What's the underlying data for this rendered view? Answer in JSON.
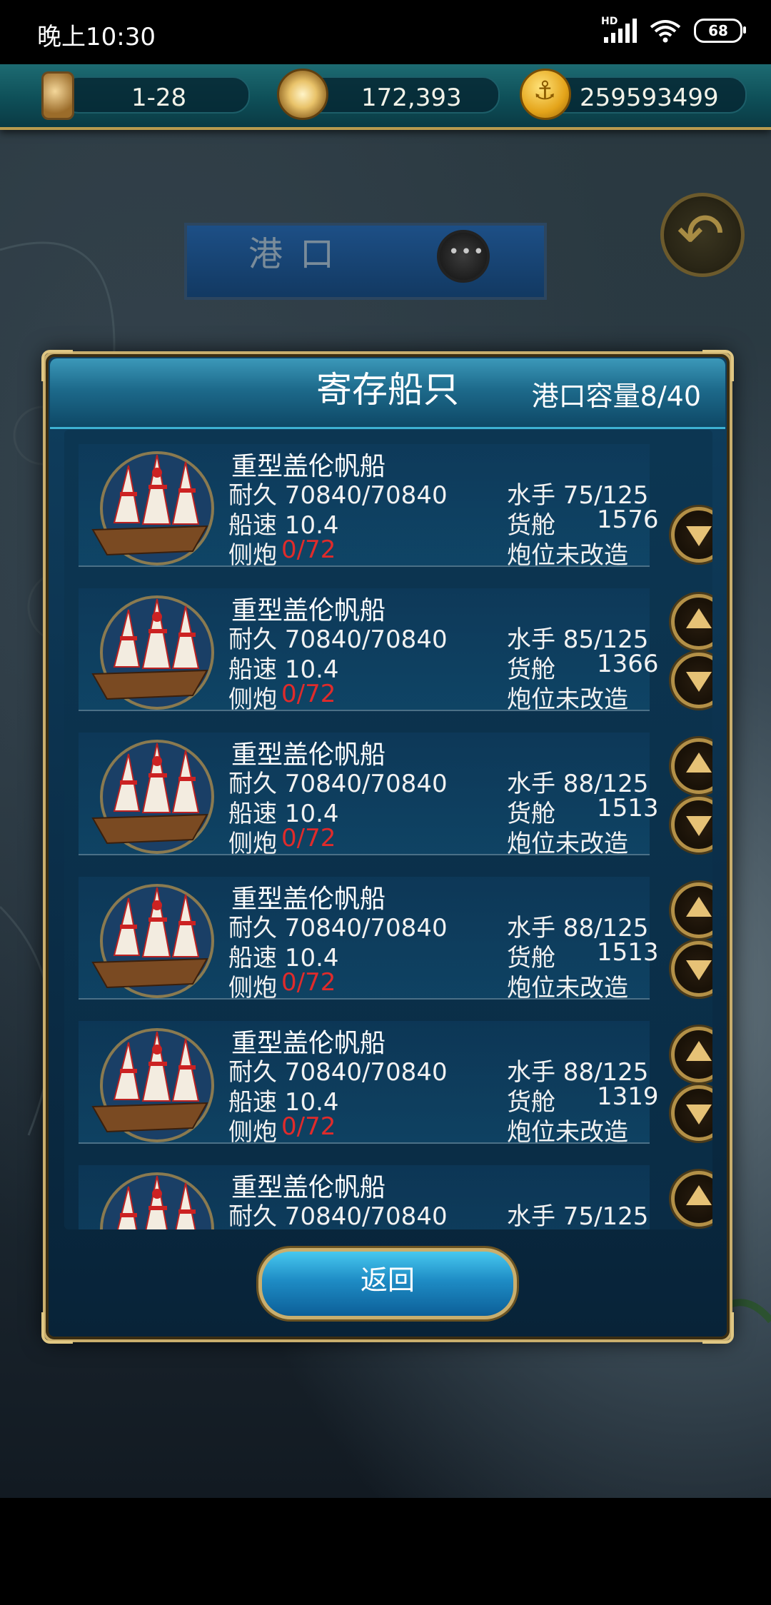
{
  "status_bar": {
    "time": "晚上10:30",
    "network": "HD",
    "battery": "68"
  },
  "resources": {
    "date": "1-28",
    "fame": "172,393",
    "gold": "259593499"
  },
  "harbor": {
    "title": "港口"
  },
  "dialog": {
    "title": "寄存船只",
    "capacity": "港口容量8/40",
    "return_label": "返回",
    "ships": [
      {
        "name": "重型盖伦帆船",
        "durability": "耐久 70840/70840",
        "speed": "船速 10.4",
        "cannon_label": "侧炮",
        "cannon_value": "0/72",
        "crew": "水手 75/125",
        "cargo_label": "货舱",
        "cargo_value": "1576",
        "gun_status": "炮位未改造"
      },
      {
        "name": "重型盖伦帆船",
        "durability": "耐久 70840/70840",
        "speed": "船速 10.4",
        "cannon_label": "侧炮",
        "cannon_value": "0/72",
        "crew": "水手 85/125",
        "cargo_label": "货舱",
        "cargo_value": "1366",
        "gun_status": "炮位未改造"
      },
      {
        "name": "重型盖伦帆船",
        "durability": "耐久 70840/70840",
        "speed": "船速 10.4",
        "cannon_label": "侧炮",
        "cannon_value": "0/72",
        "crew": "水手 88/125",
        "cargo_label": "货舱",
        "cargo_value": "1513",
        "gun_status": "炮位未改造"
      },
      {
        "name": "重型盖伦帆船",
        "durability": "耐久 70840/70840",
        "speed": "船速 10.4",
        "cannon_label": "侧炮",
        "cannon_value": "0/72",
        "crew": "水手 88/125",
        "cargo_label": "货舱",
        "cargo_value": "1513",
        "gun_status": "炮位未改造"
      },
      {
        "name": "重型盖伦帆船",
        "durability": "耐久 70840/70840",
        "speed": "船速 10.4",
        "cannon_label": "侧炮",
        "cannon_value": "0/72",
        "crew": "水手 88/125",
        "cargo_label": "货舱",
        "cargo_value": "1319",
        "gun_status": "炮位未改造"
      },
      {
        "name": "重型盖伦帆船",
        "durability": "耐久 70840/70840",
        "speed": "",
        "cannon_label": "",
        "cannon_value": "",
        "crew": "水手 75/125",
        "cargo_label": "",
        "cargo_value": "",
        "gun_status": ""
      }
    ]
  },
  "colors": {
    "accent_gold": "#c9ae6d",
    "cannon_red": "#e02b2b",
    "header_teal": "#1d6a8b"
  },
  "icons": [
    "hourglass-icon",
    "compass-icon",
    "gold-anchor-icon",
    "back-arrow-icon",
    "chat-icon",
    "galleon-icon",
    "up-arrow-icon",
    "down-arrow-icon"
  ]
}
